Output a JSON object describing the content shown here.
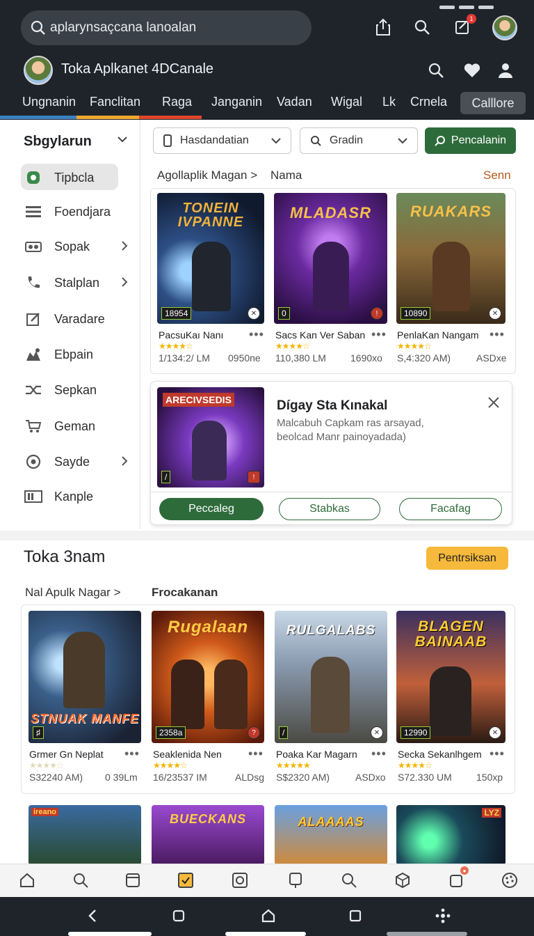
{
  "header": {
    "search_text": "aplarynsaçcana lanoalan",
    "app_title": "Toka Aplkanet 4DCanale",
    "notification_count": "1"
  },
  "nav_tabs": [
    "Ungnanin",
    "Fanclitan",
    "Raga",
    "Janganin",
    "Vadan",
    "Wigal",
    "Lk",
    "Crnela"
  ],
  "nav_pill": "Calllore",
  "sidebar": {
    "title": "Sbgylarun",
    "items": [
      {
        "label": "Tipbcla",
        "icon": "leaf-icon",
        "chevron": false
      },
      {
        "label": "Foendjara",
        "icon": "list-icon",
        "chevron": false
      },
      {
        "label": "Sopak",
        "icon": "gamepad-icon",
        "chevron": true
      },
      {
        "label": "Stalplan",
        "icon": "phone-icon",
        "chevron": true
      },
      {
        "label": "Varadare",
        "icon": "edit-icon",
        "chevron": false
      },
      {
        "label": "Ebpain",
        "icon": "puzzle-icon",
        "chevron": false
      },
      {
        "label": "Sepkan",
        "icon": "shuffle-icon",
        "chevron": false
      },
      {
        "label": "Geman",
        "icon": "cart-icon",
        "chevron": false
      },
      {
        "label": "Sayde",
        "icon": "settings-icon",
        "chevron": true
      },
      {
        "label": "Kanple",
        "icon": "library-icon",
        "chevron": false
      }
    ]
  },
  "filters": {
    "dropdown1": "Hasdandatian",
    "dropdown2": "Gradin",
    "action": "Pencalanin"
  },
  "section1": {
    "crumb1": "Agollaplik Magan",
    "crumb2": "Nama",
    "see_all": "Senn",
    "games": [
      {
        "art": "TONEIN IVPANNE",
        "badge_l": "18954",
        "name": "PacsuKaı Nanı",
        "rating": 4,
        "meta_l": "1/134:2/ LM",
        "meta_r": "0950ne"
      },
      {
        "art": "MLADASR",
        "badge_l": "",
        "name": "Sacs Kan Ver Saban",
        "rating": 4,
        "meta_l": "110,380 LM",
        "meta_r": "1690xo"
      },
      {
        "art": "RUAKARS",
        "badge_l": "10890",
        "name": "PenlaKan Nangam",
        "rating": 4,
        "meta_l": "S,4:320 AM)",
        "meta_r": "ASDxe"
      }
    ]
  },
  "promo": {
    "art": "ARECIVSEDIS",
    "title": "Dígay Sta Kınakal",
    "desc": "Malcabuh Capkam ras arsayad, beolcad Manr painoyadada)",
    "btn1": "Peccaleg",
    "btn2": "Stabkas",
    "btn3": "Facafag"
  },
  "section2": {
    "title": "Toka 3nam",
    "action": "Pentrsiksan",
    "crumb1": "Nal Apulk Nagar",
    "crumb2": "Frocakanan",
    "games": [
      {
        "art": "STNUAK MANFE",
        "badge_l": "",
        "name": "Grmer Gn Neplat",
        "rating": 4,
        "meta_l": "S32240 AM)",
        "meta_r": "0 39Lm"
      },
      {
        "art": "Rugalaan",
        "badge_l": "2358a",
        "name": "Seaklenida Nen",
        "rating": 4,
        "meta_l": "16/23537 IM",
        "meta_r": "ALDsg"
      },
      {
        "art": "RULGALABS",
        "badge_l": "",
        "name": "Poaka Kar Magarn",
        "rating": 5,
        "meta_l": "S$2320 AM)",
        "meta_r": "ASDxo"
      },
      {
        "art": "BLAGEN BAINAAB",
        "badge_l": "12990",
        "name": "Secka Sekanlhgem",
        "rating": 4,
        "meta_l": "S72.330 UM",
        "meta_r": "150xp"
      }
    ],
    "row2_art": [
      "ireano",
      "BUECKANS",
      "ALAAAAS",
      "LYZ"
    ]
  },
  "bottom_nav": [
    "home-icon",
    "search-icon",
    "tablet-icon",
    "checkbox-icon",
    "shield-icon",
    "pin-icon",
    "search-icon",
    "globe-icon",
    "notify-icon",
    "palette-icon"
  ],
  "colors": {
    "header_bg": "#1f242b",
    "accent_green": "#2e6b3b",
    "accent_yellow": "#f6b93b",
    "star": "#f4b400"
  }
}
